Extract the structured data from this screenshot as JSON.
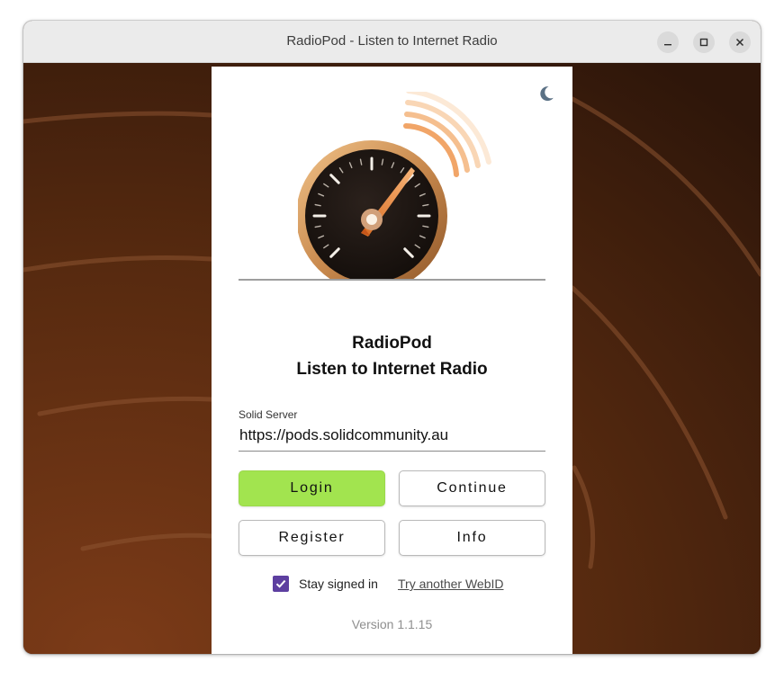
{
  "window": {
    "title": "RadioPod - Listen to Internet Radio",
    "controls": [
      "minimize-icon",
      "maximize-icon",
      "close-icon"
    ]
  },
  "header": {
    "theme_toggle_icon": "moon-icon",
    "logo_icon": "radio-gauge-logo"
  },
  "app": {
    "name": "RadioPod",
    "subtitle": "Listen to Internet Radio"
  },
  "server": {
    "label": "Solid Server",
    "value": "https://pods.solidcommunity.au"
  },
  "buttons": {
    "login": "Login",
    "continue": "Continue",
    "register": "Register",
    "info": "Info"
  },
  "options": {
    "stay_signed_in_label": "Stay signed in",
    "stay_signed_in_checked": true,
    "other_webid_link": "Try another WebID"
  },
  "footer": {
    "version": "Version 1.1.15"
  },
  "colors": {
    "login_button": "#a2e44f",
    "checkbox": "#5d3fa0",
    "background": "#5a2f14",
    "logo_accent": "#f0a060"
  }
}
